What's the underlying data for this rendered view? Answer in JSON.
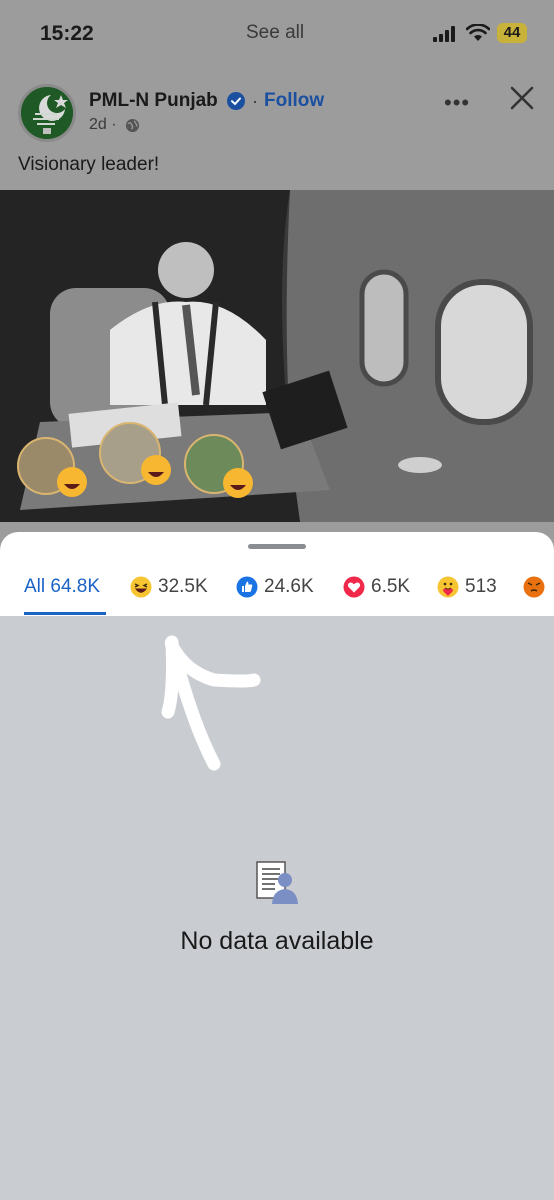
{
  "status_bar": {
    "time": "15:22",
    "center_text": "See all",
    "battery": "44"
  },
  "post": {
    "page_name": "PML-N Punjab",
    "follow_label": "Follow",
    "separator": "·",
    "time_ago": "2d ·",
    "more_label": "•••",
    "caption": "Visionary leader!"
  },
  "reactions_sheet": {
    "tabs": [
      {
        "label": "All 64.8K",
        "icon": "none",
        "selected": true
      },
      {
        "label": "32.5K",
        "icon": "haha-icon"
      },
      {
        "label": "24.6K",
        "icon": "like-icon"
      },
      {
        "label": "6.5K",
        "icon": "love-icon"
      },
      {
        "label": "513",
        "icon": "care-icon"
      },
      {
        "label": "",
        "icon": "angry-icon"
      }
    ],
    "empty_message": "No data available"
  },
  "colors": {
    "accent": "#1b63c4",
    "follow": "#1b4fa0",
    "sheet_bg": "#c9ccd1",
    "dimmed_bg": "#9c9c9c",
    "scribble": "#ffffff"
  }
}
